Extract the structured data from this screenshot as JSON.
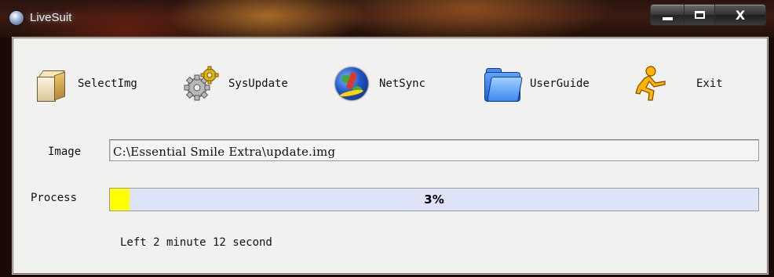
{
  "window": {
    "title": "LiveSuit",
    "title_icon": "livesuit-app-icon",
    "caption_buttons": [
      {
        "name": "minimize",
        "icon": "minimize-icon"
      },
      {
        "name": "maximize",
        "icon": "maximize-icon"
      },
      {
        "name": "close",
        "icon": "close-icon",
        "glyph": "X"
      }
    ]
  },
  "toolbar": {
    "items": [
      {
        "label": "SelectImg",
        "icon": "box-icon"
      },
      {
        "label": "SysUpdate",
        "icon": "gears-icon"
      },
      {
        "label": "NetSync",
        "icon": "globe-icon"
      },
      {
        "label": "UserGuide",
        "icon": "folder-icon"
      },
      {
        "label": "Exit",
        "icon": "running-man-icon"
      }
    ]
  },
  "image": {
    "label": "Image",
    "value": "C:\\Essential Smile Extra\\update.img"
  },
  "process": {
    "label": "Process",
    "percent": 3,
    "percent_text": "3%",
    "fill_color": "#ffff00",
    "track_color": "#dfe3f7"
  },
  "status": {
    "time_left": "Left 2 minute 12 second"
  }
}
